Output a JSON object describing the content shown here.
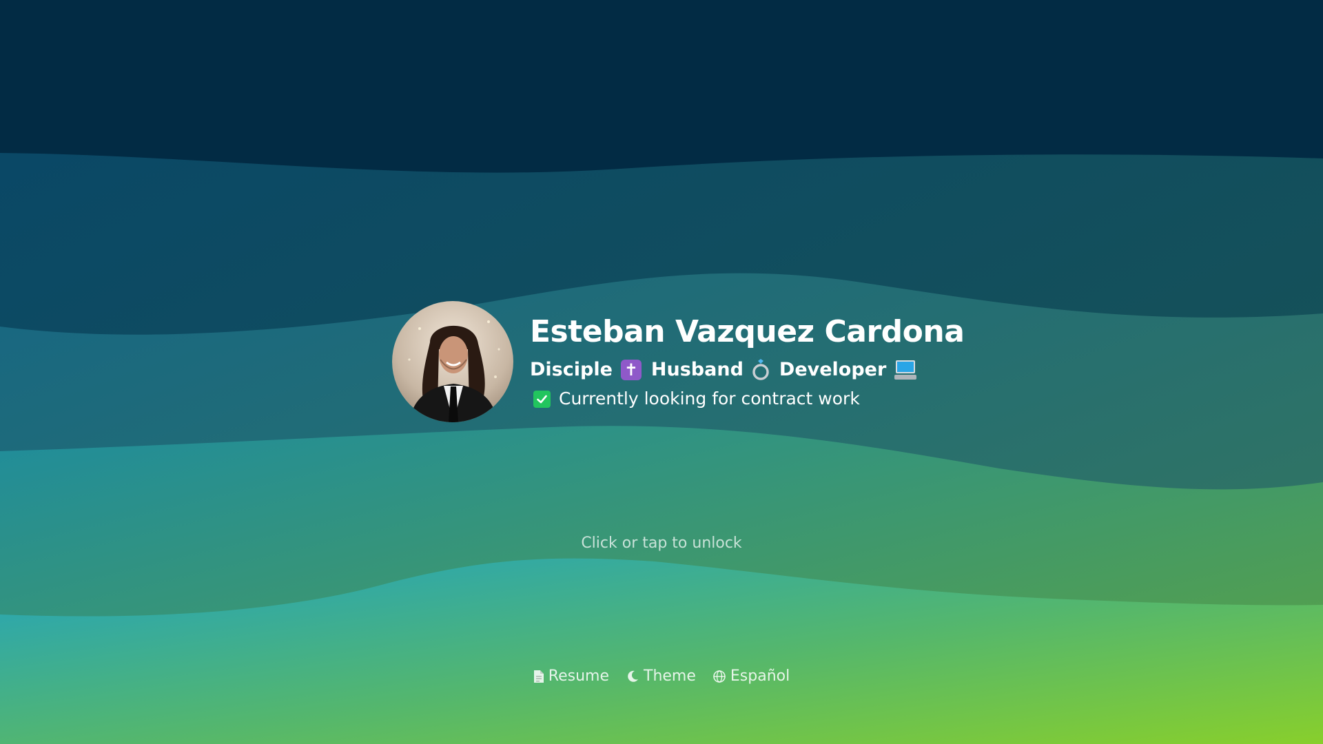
{
  "profile": {
    "name": "Esteban Vazquez Cardona",
    "roles": [
      "Disciple",
      "Husband",
      "Developer"
    ],
    "role_icons": [
      "cross-icon",
      "ring-icon",
      "computer-icon"
    ],
    "status_text": "Currently looking for contract work",
    "status_icon": "check-mark-icon",
    "avatar_icon": "profile-photo"
  },
  "lock_screen": {
    "unlock_hint": "Click or tap to unlock"
  },
  "footer": {
    "links": [
      {
        "label": "Resume",
        "icon": "document-icon"
      },
      {
        "label": "Theme",
        "icon": "moon-icon"
      },
      {
        "label": "Español",
        "icon": "globe-icon"
      }
    ]
  },
  "colors": {
    "background_top": "#022b44",
    "background_bottom": "#84cc2f",
    "accent_check": "#22c55e",
    "accent_cross": "#8f59c9"
  }
}
